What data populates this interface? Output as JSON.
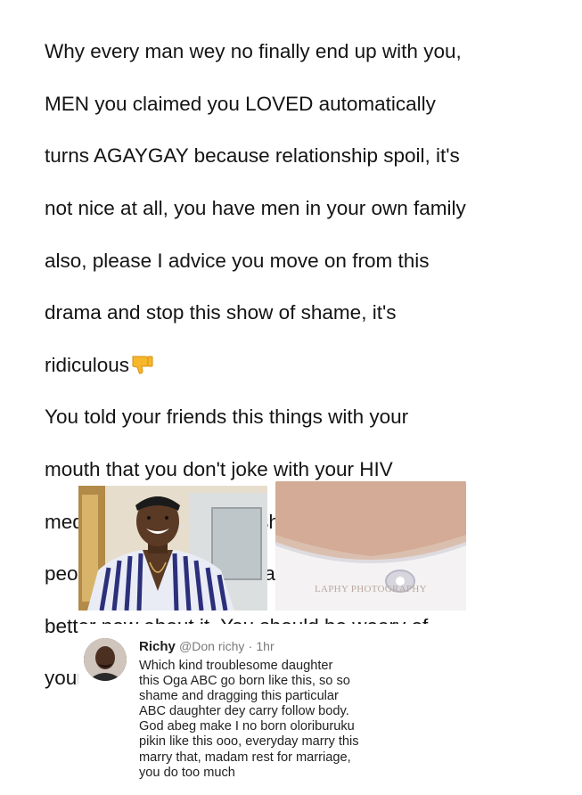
{
  "post": {
    "lines": [
      "Why every man wey no finally end up with you,",
      "MEN you claimed you LOVED automatically",
      "turns AGAYGAY because relationship spoil, it's",
      "not nice at all, you have men in your own family",
      "also, please I advice you move on from this",
      "drama and stop this show of shame, it's",
      "ridiculous",
      "You told your friends this things with your",
      "mouth that you don't joke with your HIV",
      "medication, so why feel shame about it, I know",
      "people like you with HIV and they're ok and feel",
      "better now about it. You should be weary of",
      "your supposed \"close friends\"."
    ],
    "emoji": "thumbs-down-emoji"
  },
  "photos": {
    "left": "man-in-striped-shirt-photo",
    "right": "woman-neckline-photo",
    "watermark": "LAPHY PHOTOGRAPHY"
  },
  "comment": {
    "author": "Richy",
    "handle": "@Don richy",
    "separator": "·",
    "time": "1hr",
    "lines": [
      "Which kind troublesome daughter",
      "this Oga ABC go born like this, so so",
      "shame and dragging this particular",
      "ABC daughter dey carry follow body.",
      "God abeg make I no born oloriburuku",
      "pikin like this ooo, everyday marry this",
      "marry that, madam rest for marriage,",
      "you do too much"
    ]
  }
}
